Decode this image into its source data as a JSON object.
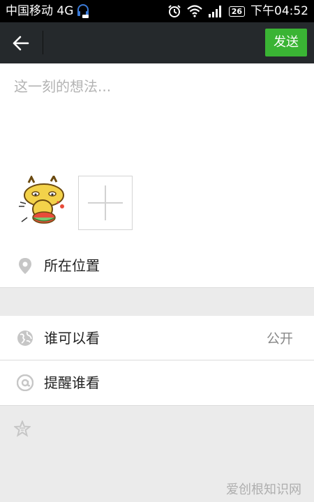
{
  "status_bar": {
    "carrier": "中国移动 4G",
    "battery": "26",
    "time": "下午04:52"
  },
  "toolbar": {
    "send_label": "发送"
  },
  "compose": {
    "placeholder": "这一刻的想法..."
  },
  "rows": {
    "location_label": "所在位置",
    "visibility_label": "谁可以看",
    "visibility_value": "公开",
    "remind_label": "提醒谁看"
  },
  "watermark": "爱创根知识网",
  "colors": {
    "accent": "#3ab434",
    "appbar": "#25292c",
    "statusbar": "#000000",
    "background": "#ebebeb"
  },
  "icons": [
    "back-arrow-icon",
    "location-pin-icon",
    "globe-icon",
    "at-icon",
    "star-icon",
    "headset-icon",
    "alarm-icon",
    "wifi-icon",
    "signal-icon",
    "plus-icon"
  ]
}
